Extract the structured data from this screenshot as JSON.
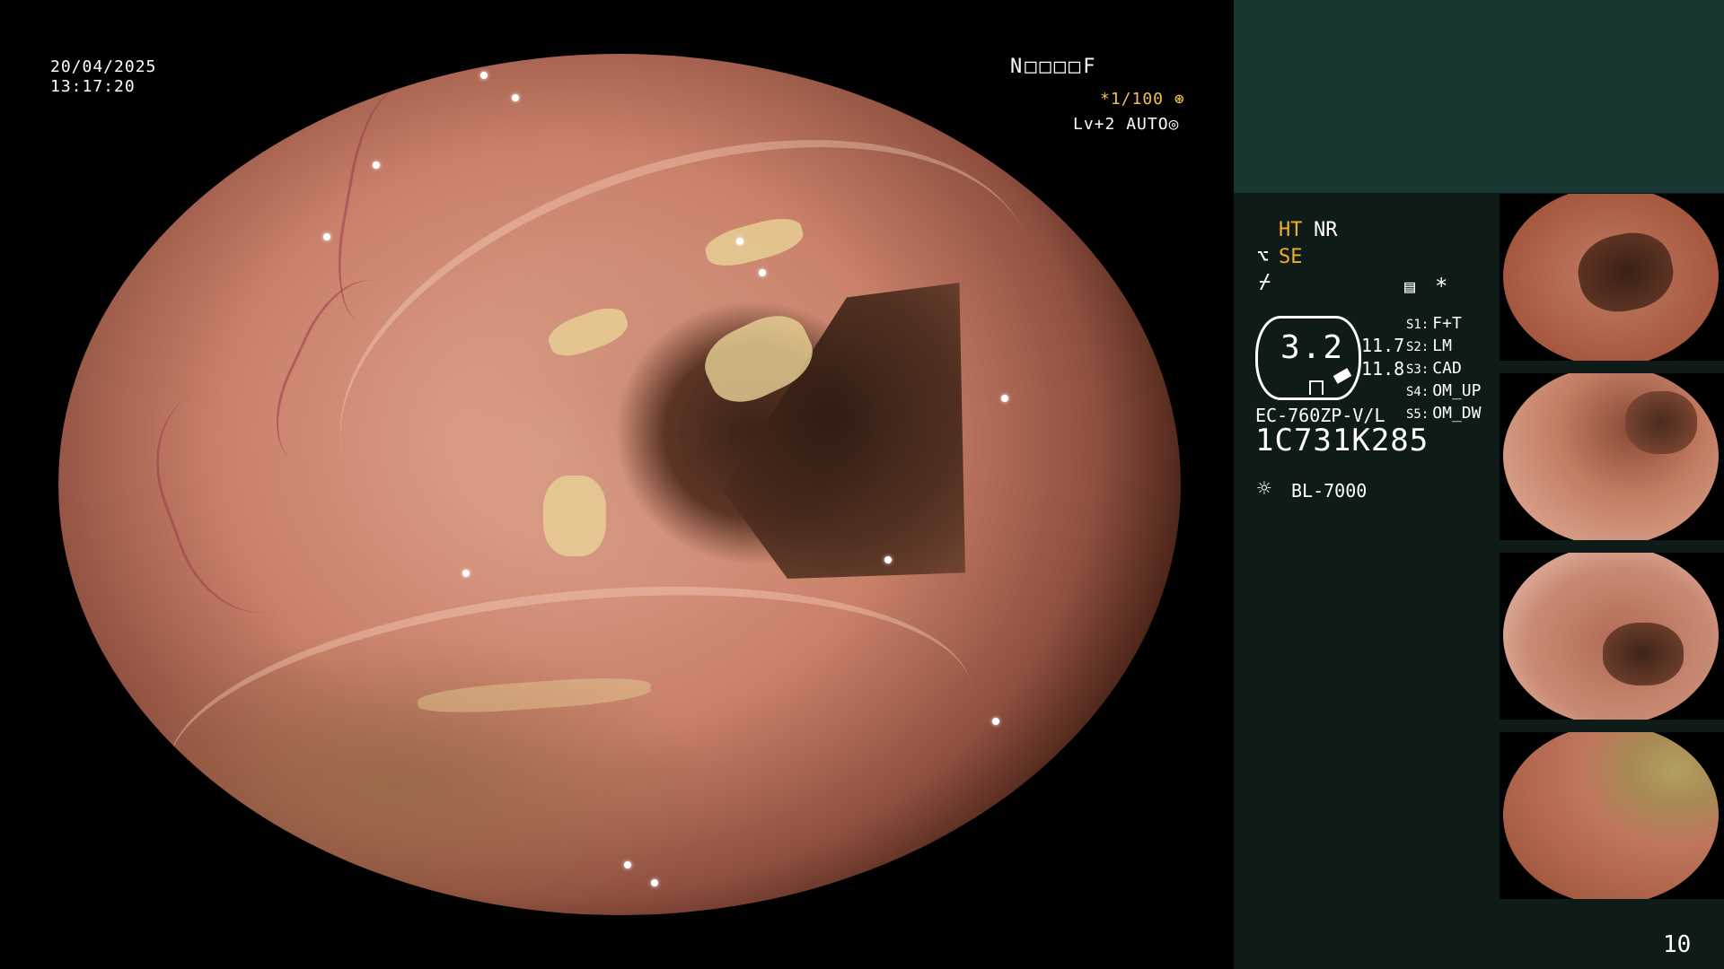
{
  "overlay": {
    "date": "20/04/2025",
    "time": "13:17:20",
    "code": "N□□□□F",
    "exposure": "*1/100",
    "level": "Lv+2",
    "mode": "AUTO"
  },
  "panel": {
    "ht": "HT",
    "nr": "NR",
    "se": "SE",
    "scope_icon": "scope-icon",
    "wave_icon": "wave-icon",
    "badge_value": "3.2",
    "value_1": "11.7",
    "value_2": "11.8",
    "model": "EC-760ZP-V/L",
    "serial": "1C731K285",
    "light": "BL-7000",
    "star": "*",
    "settings": [
      {
        "key": "S1:",
        "value": "F+T"
      },
      {
        "key": "S2:",
        "value": "LM"
      },
      {
        "key": "S3:",
        "value": "CAD"
      },
      {
        "key": "S4:",
        "value": "OM_UP"
      },
      {
        "key": "S5:",
        "value": "OM_DW"
      }
    ]
  },
  "page_number": "10",
  "colors": {
    "accent": "#f0b020",
    "panel_top": "#183632",
    "panel": "#0f1b19"
  }
}
